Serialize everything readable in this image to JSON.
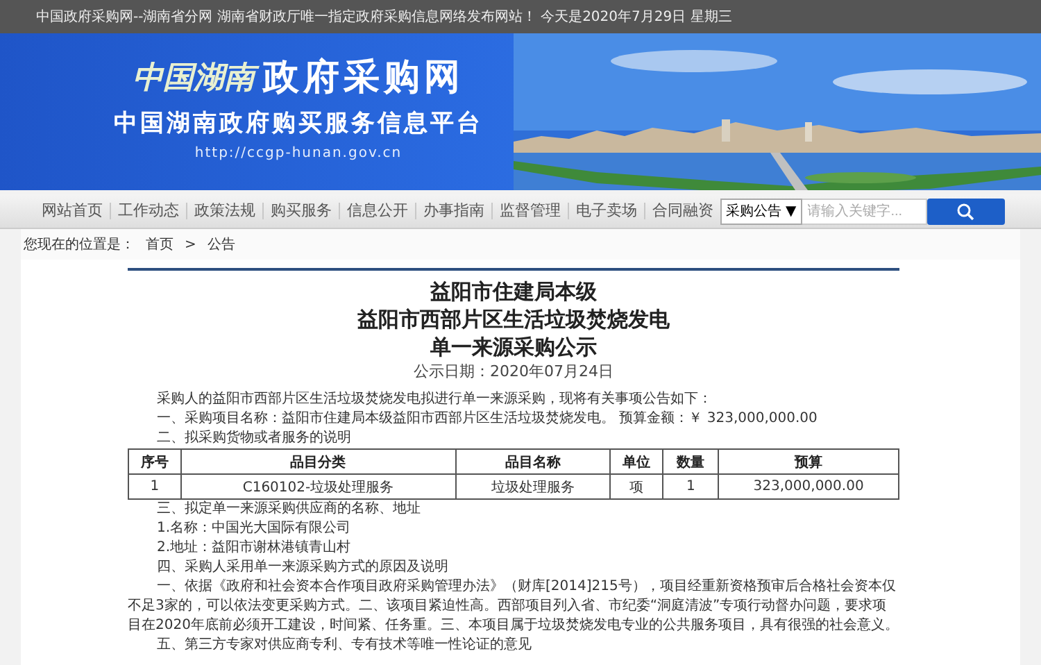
{
  "top_bar": {
    "text": "中国政府采购网--湖南省分网  湖南省财政厅唯一指定政府采购信息网络发布网站！ 今天是2020年7月29日  星期三"
  },
  "header": {
    "logo_script": "中国湖南",
    "site_name": "政府采购网",
    "subtitle": "中国湖南政府购买服务信息平台",
    "url": "http://ccgp-hunan.gov.cn"
  },
  "nav": {
    "items": [
      "网站首页",
      "工作动态",
      "政策法规",
      "购买服务",
      "信息公开",
      "办事指南",
      "监督管理",
      "电子卖场",
      "合同融资"
    ],
    "search": {
      "category": "采购公告",
      "arrow": "▼",
      "placeholder": "请输入关键字..."
    }
  },
  "breadcrumb": {
    "label": "您现在的位置是：",
    "items": [
      "首页",
      "公告"
    ],
    "separator": ">"
  },
  "article": {
    "title_lines": [
      "益阳市住建局本级",
      "益阳市西部片区生活垃圾焚烧发电",
      "单一来源采购公示"
    ],
    "date": "公示日期：2020年07月24日",
    "paragraphs_before": [
      "采购人的益阳市西部片区生活垃圾焚烧发电拟进行单一来源采购，现将有关事项公告如下：",
      "一、采购项目名称：益阳市住建局本级益阳市西部片区生活垃圾焚烧发电。 预算金额：￥ 323,000,000.00",
      "二、拟采购货物或者服务的说明"
    ],
    "table": {
      "columns": [
        "序号",
        "品目分类",
        "品目名称",
        "单位",
        "数量",
        "预算"
      ],
      "rows": [
        [
          "1",
          "C160102-垃圾处理服务",
          "垃圾处理服务",
          "项",
          "1",
          "323,000,000.00"
        ]
      ]
    },
    "paragraphs_after": [
      "三、拟定单一来源采购供应商的名称、地址",
      "1.名称：中国光大国际有限公司",
      "2.地址：益阳市谢林港镇青山村",
      "四、采购人采用单一来源采购方式的原因及说明",
      "一、依据《政府和社会资本合作项目政府采购管理办法》（财库[2014]215号），项目经重新资格预审后合格社会资本仅不足3家的，可以依法变更采购方式。二、该项目紧迫性高。西部项目列入省、市纪委“洞庭清波”专项行动督办问题，要求项目在2020年底前必须开工建设，时间紧、任务重。三、本项目属于垃圾焚烧发电专业的公共服务项目，具有很强的社会意义。",
      "五、第三方专家对供应商专利、专有技术等唯一性论证的意见"
    ]
  }
}
